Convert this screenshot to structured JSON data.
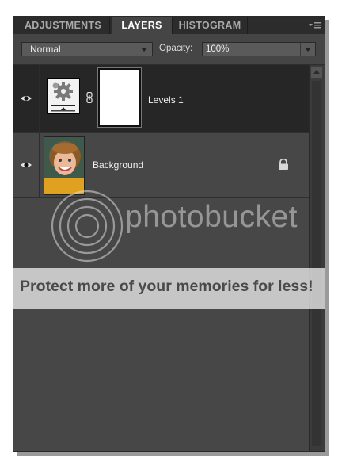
{
  "tabs": [
    {
      "label": "ADJUSTMENTS"
    },
    {
      "label": "LAYERS"
    },
    {
      "label": "HISTOGRAM"
    }
  ],
  "options": {
    "blend_mode": "Normal",
    "opacity_label": "Opacity:",
    "opacity_value": "100%"
  },
  "layers": [
    {
      "name": "Levels 1",
      "type": "adjustment",
      "visible": true,
      "selected": true
    },
    {
      "name": "Background",
      "type": "image",
      "visible": true,
      "locked": true
    }
  ],
  "watermark": {
    "brand": "photobucket",
    "banner": "Protect more of your memories for less!"
  },
  "colors": {
    "panel": "#434343",
    "selected_row": "#262626",
    "tab_bar": "#2c2c2c"
  }
}
